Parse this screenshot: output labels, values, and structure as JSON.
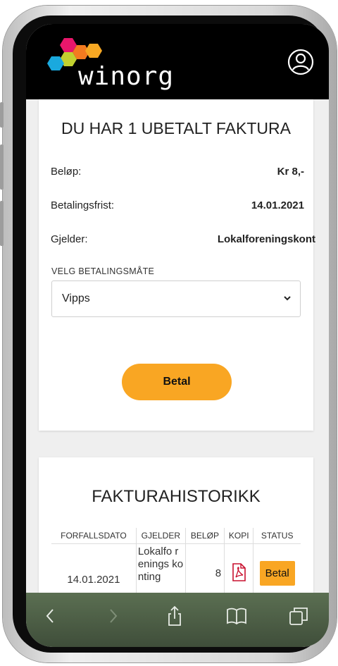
{
  "header": {
    "logo_text": "winorg",
    "profile_icon": "user-circle-icon"
  },
  "invoice": {
    "title": "DU HAR 1 UBETALT FAKTURA",
    "amount_label": "Beløp:",
    "amount_value": "Kr 8,-",
    "due_label": "Betalingsfrist:",
    "due_value": "14.01.2021",
    "regarding_label": "Gjelder:",
    "regarding_value": "Lokalforeningskont",
    "method_label": "VELG BETALINGSMÅTE",
    "method_selected": "Vipps",
    "pay_label": "Betal"
  },
  "history": {
    "title": "FAKTURAHISTORIKK",
    "columns": [
      "FORFALLSDATO",
      "GJELDER",
      "BELØP",
      "KOPI",
      "STATUS"
    ],
    "rows": [
      {
        "date": "14.01.2021",
        "regarding": "Lokalfo renings konting",
        "amount": "8",
        "copy_icon": "pdf-icon",
        "status": "Betal"
      }
    ]
  },
  "toolbar": {
    "icons": [
      "back-icon",
      "forward-icon",
      "share-icon",
      "bookmarks-icon",
      "tabs-icon"
    ]
  },
  "colors": {
    "accent": "#f9a623",
    "header_bg": "#000000",
    "page_bg": "#efefef",
    "toolbar": "#4e5f47",
    "pdf_red": "#c8102e"
  }
}
